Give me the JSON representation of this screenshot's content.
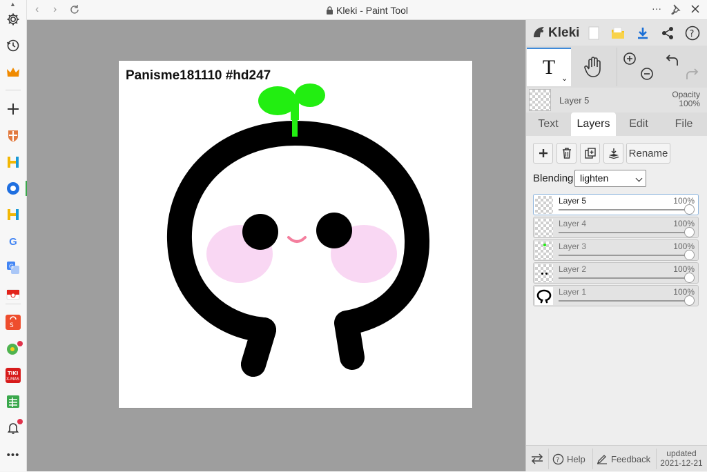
{
  "browser": {
    "title": "Kleki - Paint Tool",
    "more_label": "···"
  },
  "canvas": {
    "text": "Panisme181110  #hd247"
  },
  "panel": {
    "logo": "Kleki",
    "current_layer": "Layer 5",
    "opacity_label": "Opacity",
    "opacity_value": "100%",
    "tabs": [
      "Text",
      "Layers",
      "Edit",
      "File"
    ],
    "active_tab": "Layers",
    "rename_label": "Rename",
    "blending_label": "Blending",
    "blending_value": "lighten",
    "layers": [
      {
        "name": "Layer 5",
        "opacity": "100%",
        "selected": true
      },
      {
        "name": "Layer 4",
        "opacity": "100%",
        "selected": false
      },
      {
        "name": "Layer 3",
        "opacity": "100%",
        "selected": false
      },
      {
        "name": "Layer 2",
        "opacity": "100%",
        "selected": false
      },
      {
        "name": "Layer 1",
        "opacity": "100%",
        "selected": false
      }
    ],
    "footer": {
      "help": "Help",
      "feedback": "Feedback",
      "updated_label": "updated",
      "updated_date": "2021-12-21"
    }
  },
  "colors": {
    "accent": "#3f8ad9",
    "sprout": "#22ee11",
    "blush": "#f7d3f0"
  }
}
